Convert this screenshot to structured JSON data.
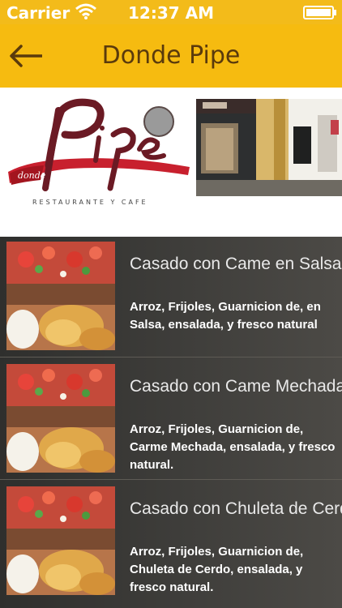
{
  "status_bar": {
    "carrier": "Carrier",
    "time": "12:37 AM",
    "wifi_icon": "wifi-icon",
    "battery_icon": "battery-icon"
  },
  "nav": {
    "title": "Donde Pipe",
    "back_icon": "back-arrow-icon"
  },
  "banner": {
    "logo_script": "Pipe",
    "logo_tag": "donde",
    "logo_tagline": "RESTAURANTE Y CAFE"
  },
  "menu": {
    "items": [
      {
        "name": "Casado con Came en Salsa",
        "description": "Arroz, Frijoles, Guarnicion de, en Salsa, ensalada, y fresco natural"
      },
      {
        "name": "Casado con Came Mechada",
        "description": "Arroz, Frijoles, Guarnicion de, Carme Mechada, ensalada, y fresco natural."
      },
      {
        "name": "Casado con Chuleta de Cerdo",
        "description": "Arroz, Frijoles, Guarnicion de, Chuleta de Cerdo, ensalada, y fresco natural."
      }
    ]
  },
  "colors": {
    "accent": "#f6bb10",
    "title_text": "#5a3a0c",
    "list_bg": "#3f3e3b",
    "logo_red": "#8b1d28"
  }
}
